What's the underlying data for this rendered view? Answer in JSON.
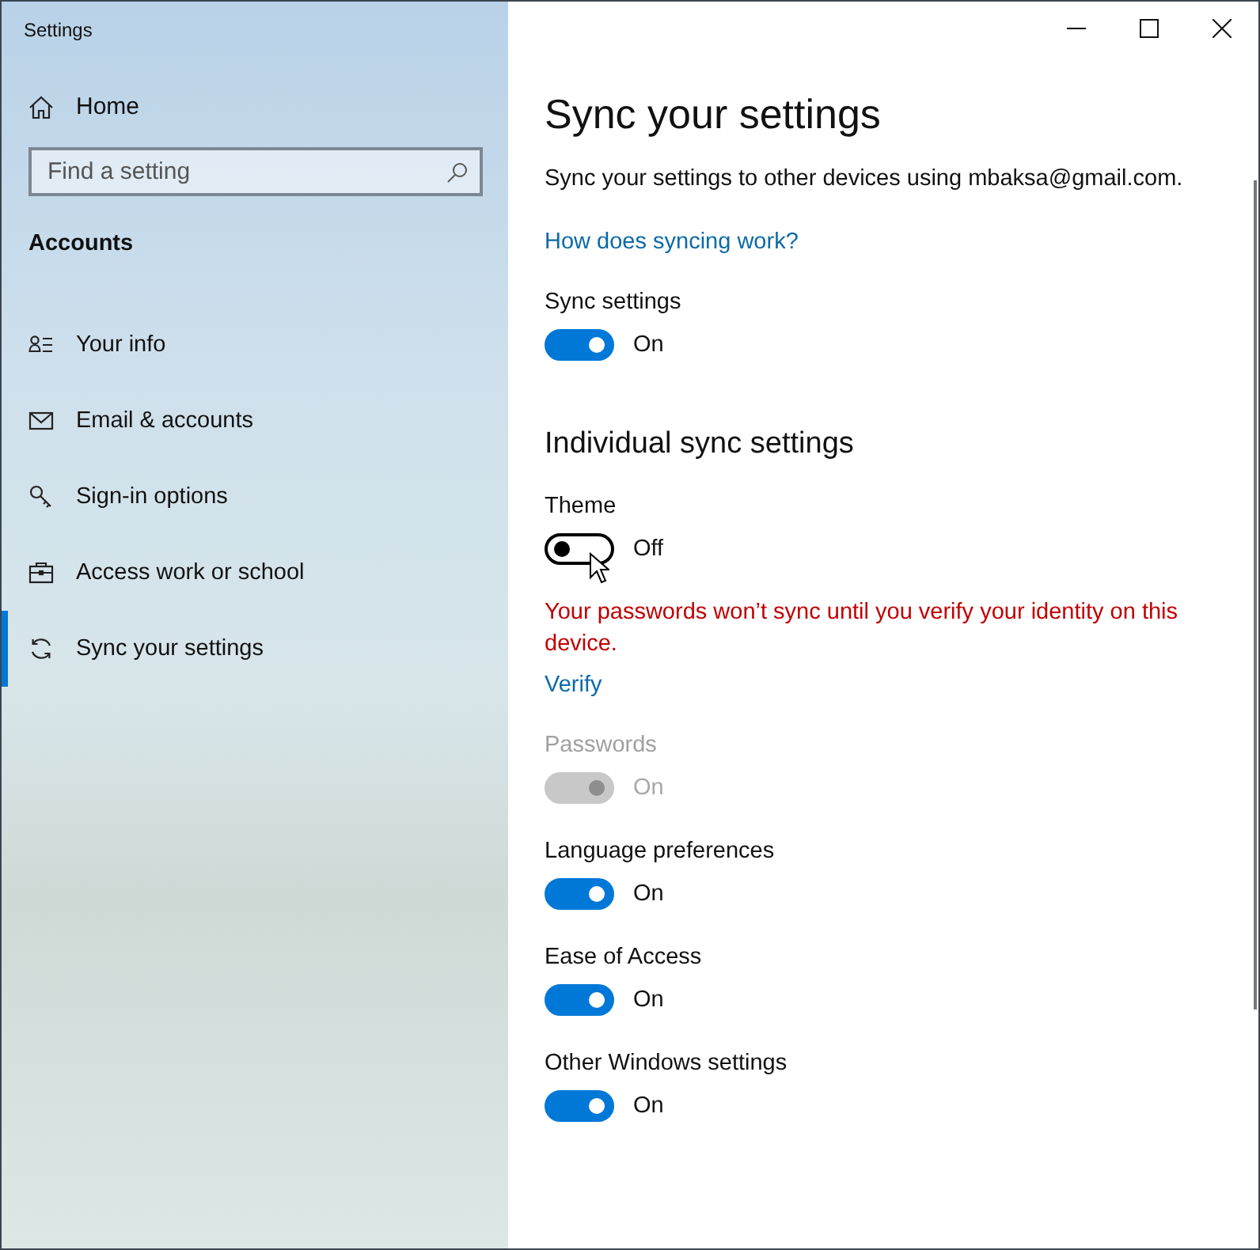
{
  "window": {
    "title": "Settings"
  },
  "sidebar": {
    "home": "Home",
    "search": {
      "placeholder": "Find a setting"
    },
    "section": "Accounts",
    "items": [
      {
        "label": "Your info",
        "selected": false
      },
      {
        "label": "Email & accounts",
        "selected": false
      },
      {
        "label": "Sign-in options",
        "selected": false
      },
      {
        "label": "Access work or school",
        "selected": false
      },
      {
        "label": "Sync your settings",
        "selected": true
      }
    ]
  },
  "page": {
    "title": "Sync your settings",
    "description": "Sync your settings to other devices using mbaksa@gmail.com.",
    "help_link": "How does syncing work?",
    "main_toggle": {
      "label": "Sync settings",
      "on": true,
      "disabled": false,
      "state_text": "On"
    },
    "section_title": "Individual sync settings",
    "items": [
      {
        "kind": "toggle",
        "label": "Theme",
        "on": false,
        "disabled": false,
        "state_text": "Off"
      },
      {
        "kind": "warning",
        "text": "Your passwords won’t sync until you verify your identity on this device."
      },
      {
        "kind": "link",
        "text": "Verify"
      },
      {
        "kind": "toggle",
        "label": "Passwords",
        "on": true,
        "disabled": true,
        "state_text": "On"
      },
      {
        "kind": "toggle",
        "label": "Language preferences",
        "on": true,
        "disabled": false,
        "state_text": "On"
      },
      {
        "kind": "toggle",
        "label": "Ease of Access",
        "on": true,
        "disabled": false,
        "state_text": "On"
      },
      {
        "kind": "toggle",
        "label": "Other Windows settings",
        "on": true,
        "disabled": false,
        "state_text": "On"
      }
    ]
  }
}
